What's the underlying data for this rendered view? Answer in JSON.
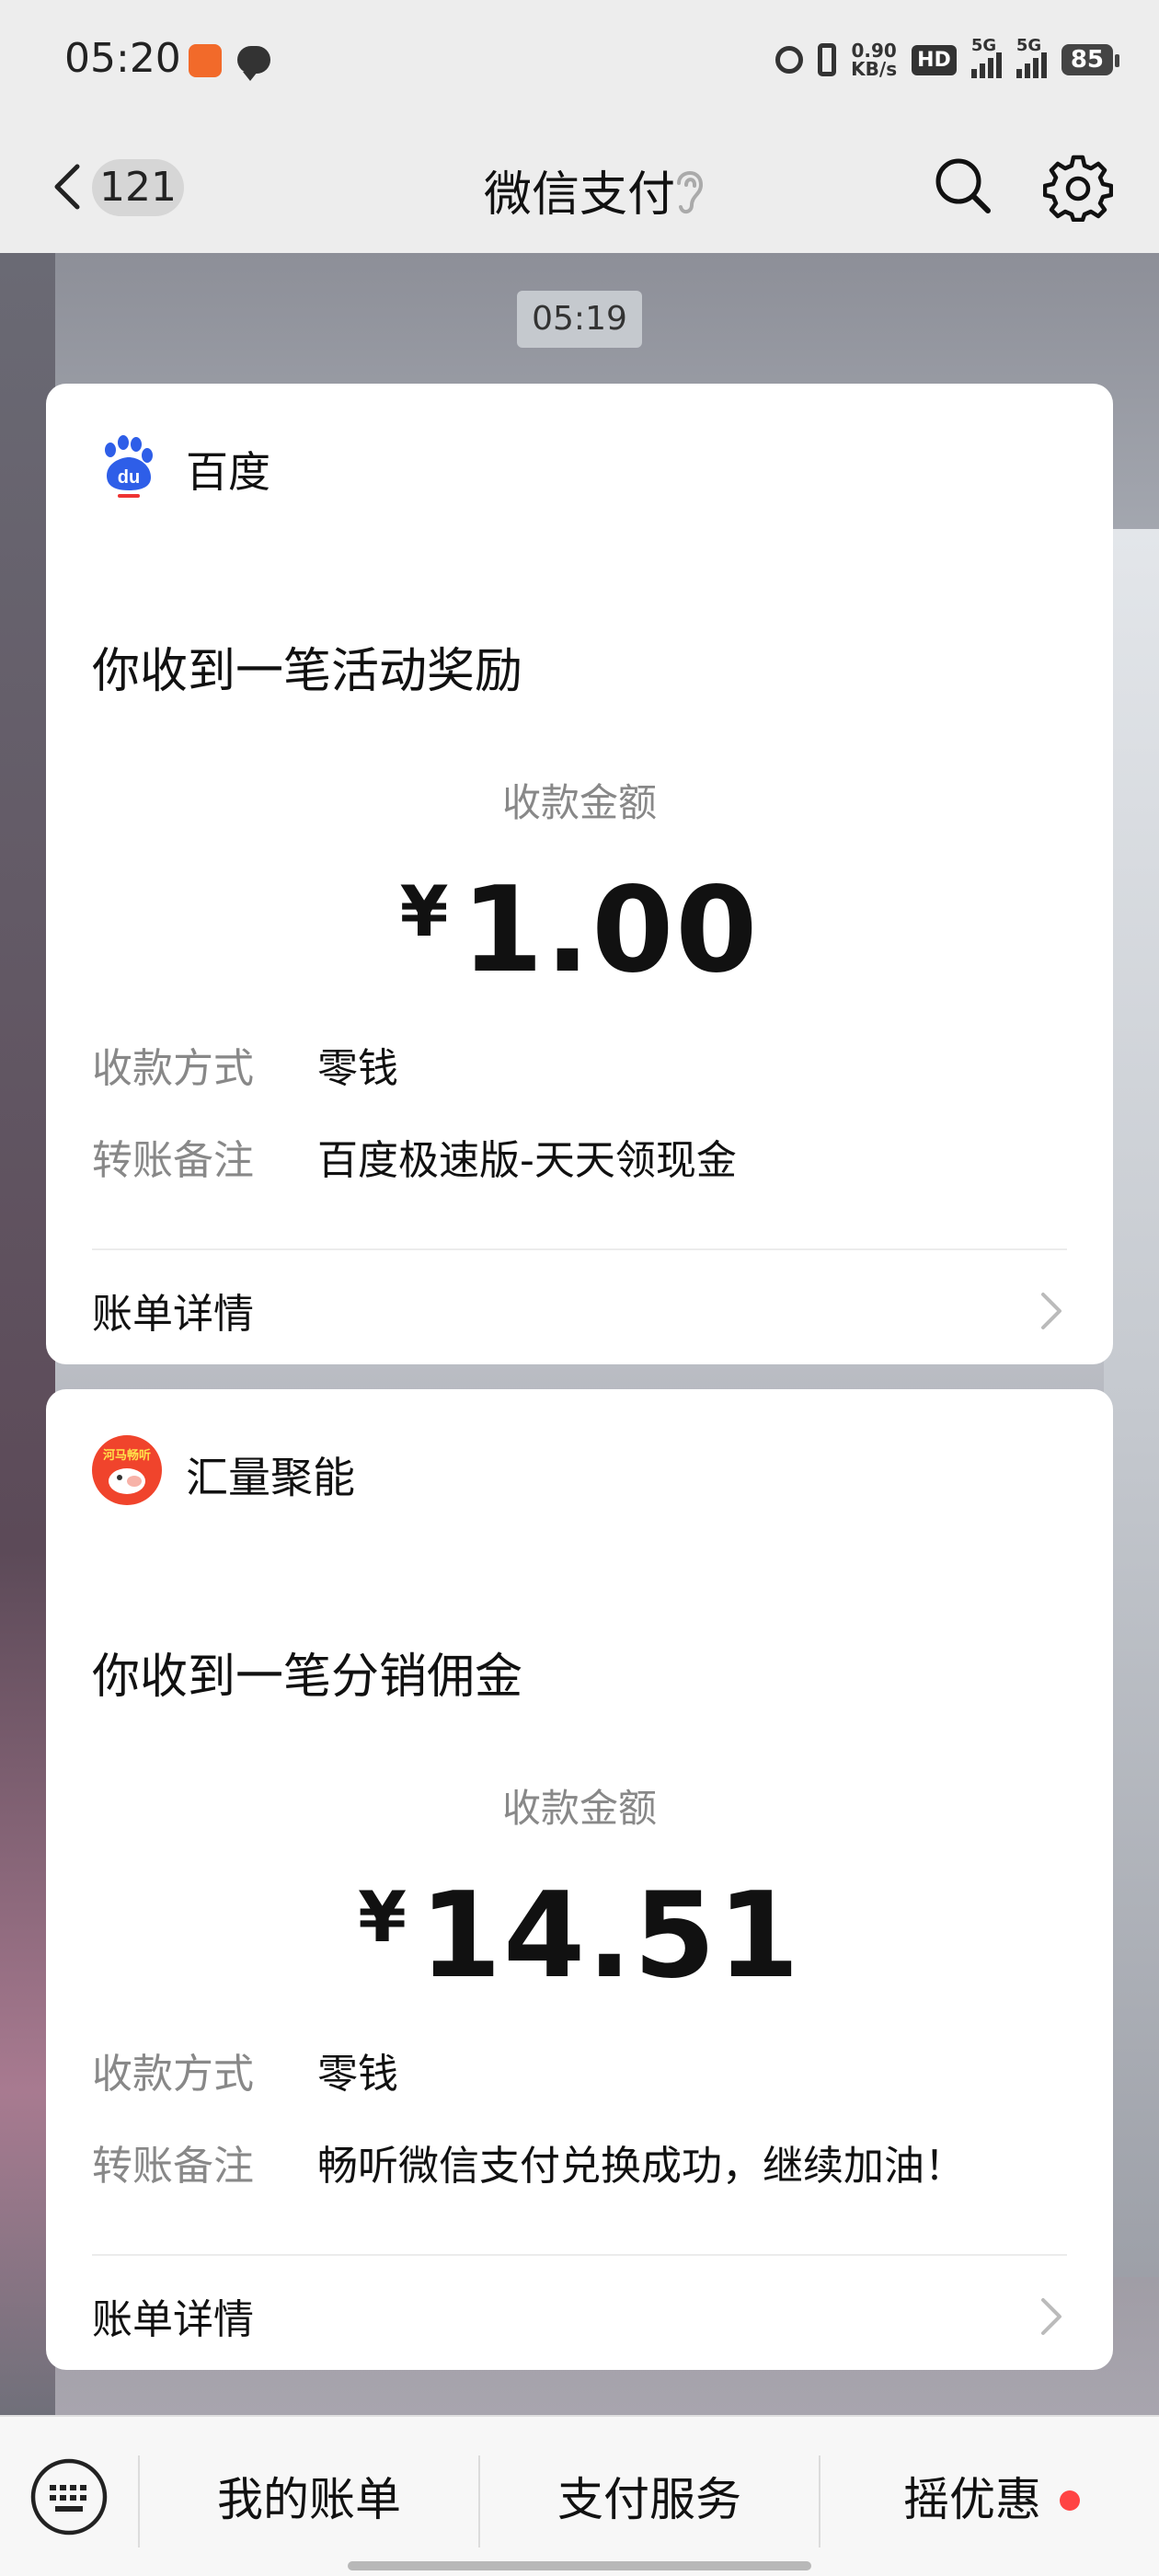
{
  "status_bar": {
    "time": "05:20",
    "net_speed_value": "0.90",
    "net_speed_unit": "KB/s",
    "hd_label": "HD",
    "sim1_label": "5G",
    "sim2_label": "5G",
    "battery": "85"
  },
  "header": {
    "unread_count": "121",
    "title": "微信支付"
  },
  "chat": {
    "timestamp": "05:19",
    "messages": [
      {
        "sender": "百度",
        "logo_text": "du",
        "headline": "你收到一笔活动奖励",
        "amount_label": "收款金额",
        "currency": "¥",
        "amount": "1.00",
        "method_label": "收款方式",
        "method_value": "零钱",
        "note_label": "转账备注",
        "note_value": "百度极速版-天天领现金",
        "detail_label": "账单详情"
      },
      {
        "sender": "汇量聚能",
        "logo_text": "河马畅听",
        "headline": "你收到一笔分销佣金",
        "amount_label": "收款金额",
        "currency": "¥",
        "amount": "14.51",
        "method_label": "收款方式",
        "method_value": "零钱",
        "note_label": "转账备注",
        "note_value": "畅听微信支付兑换成功，继续加油！",
        "detail_label": "账单详情"
      }
    ]
  },
  "bottom_menu": {
    "items": [
      "我的账单",
      "支付服务",
      "摇优惠"
    ]
  },
  "colors": {
    "background": "#ededed",
    "card": "#ffffff",
    "notify_dot": "#ff4444",
    "baidu_blue": "#2e5ee8",
    "hema_red": "#f0442c"
  },
  "icons": [
    "back-arrow-icon",
    "ear-icon",
    "search-icon",
    "gear-icon",
    "chevron-right-icon",
    "keyboard-icon"
  ]
}
